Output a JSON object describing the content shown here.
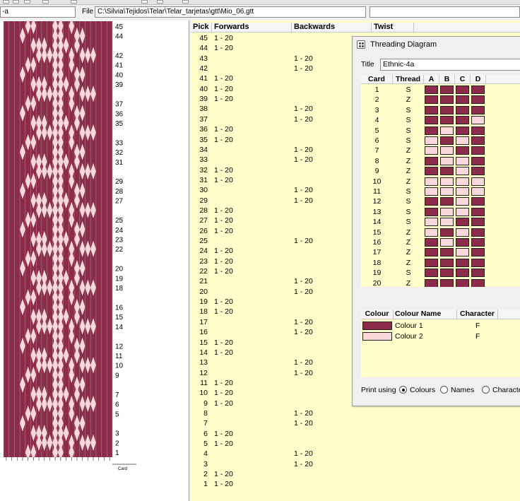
{
  "app": {
    "name_field_value": "-a",
    "file_label": "File",
    "file_path": "C:\\Silvia\\Tejidos\\Telar\\Telar_tarjetas\\gtt\\Mio_06.gtt"
  },
  "colors": {
    "colour1": "#8b2c4a",
    "colour2": "#f9d8dc",
    "pick_table_bg": "#ffffcc"
  },
  "draft": {
    "card_axis_label": "Card",
    "pick_axis_labels": [
      {
        "v": "45",
        "pick": 45
      },
      {
        "v": "44",
        "pick": 44
      },
      {
        "v": "42",
        "pick": 42
      },
      {
        "v": "41",
        "pick": 41
      },
      {
        "v": "40",
        "pick": 40
      },
      {
        "v": "39",
        "pick": 39
      },
      {
        "v": "37",
        "pick": 37
      },
      {
        "v": "36",
        "pick": 36
      },
      {
        "v": "35",
        "pick": 35
      },
      {
        "v": "33",
        "pick": 33
      },
      {
        "v": "32",
        "pick": 32
      },
      {
        "v": "31",
        "pick": 31
      },
      {
        "v": "29",
        "pick": 29
      },
      {
        "v": "28",
        "pick": 28
      },
      {
        "v": "27",
        "pick": 27
      },
      {
        "v": "25",
        "pick": 25
      },
      {
        "v": "24",
        "pick": 24
      },
      {
        "v": "23",
        "pick": 23
      },
      {
        "v": "22",
        "pick": 22
      },
      {
        "v": "20",
        "pick": 20
      },
      {
        "v": "19",
        "pick": 19
      },
      {
        "v": "18",
        "pick": 18
      },
      {
        "v": "16",
        "pick": 16
      },
      {
        "v": "15",
        "pick": 15
      },
      {
        "v": "14",
        "pick": 14
      },
      {
        "v": "12",
        "pick": 12
      },
      {
        "v": "11",
        "pick": 11
      },
      {
        "v": "10",
        "pick": 10
      },
      {
        "v": "9",
        "pick": 9
      },
      {
        "v": "7",
        "pick": 7
      },
      {
        "v": "6",
        "pick": 6
      },
      {
        "v": "5",
        "pick": 5
      },
      {
        "v": "3",
        "pick": 3
      },
      {
        "v": "2",
        "pick": 2
      },
      {
        "v": "1",
        "pick": 1
      }
    ]
  },
  "pick_table": {
    "headers": {
      "pick": "Pick",
      "forwards": "Forwards",
      "backwards": "Backwards",
      "twist": "Twist"
    },
    "rows": [
      {
        "pick": "45",
        "fwd": "1 - 20",
        "bwd": ""
      },
      {
        "pick": "44",
        "fwd": "1 - 20",
        "bwd": ""
      },
      {
        "pick": "43",
        "fwd": "",
        "bwd": "1 - 20"
      },
      {
        "pick": "42",
        "fwd": "",
        "bwd": "1 - 20"
      },
      {
        "pick": "41",
        "fwd": "1 - 20",
        "bwd": ""
      },
      {
        "pick": "40",
        "fwd": "1 - 20",
        "bwd": ""
      },
      {
        "pick": "39",
        "fwd": "1 - 20",
        "bwd": ""
      },
      {
        "pick": "38",
        "fwd": "",
        "bwd": "1 - 20"
      },
      {
        "pick": "37",
        "fwd": "",
        "bwd": "1 - 20"
      },
      {
        "pick": "36",
        "fwd": "1 - 20",
        "bwd": ""
      },
      {
        "pick": "35",
        "fwd": "1 - 20",
        "bwd": ""
      },
      {
        "pick": "34",
        "fwd": "",
        "bwd": "1 - 20"
      },
      {
        "pick": "33",
        "fwd": "",
        "bwd": "1 - 20"
      },
      {
        "pick": "32",
        "fwd": "1 - 20",
        "bwd": ""
      },
      {
        "pick": "31",
        "fwd": "1 - 20",
        "bwd": ""
      },
      {
        "pick": "30",
        "fwd": "",
        "bwd": "1 - 20"
      },
      {
        "pick": "29",
        "fwd": "",
        "bwd": "1 - 20"
      },
      {
        "pick": "28",
        "fwd": "1 - 20",
        "bwd": ""
      },
      {
        "pick": "27",
        "fwd": "1 - 20",
        "bwd": ""
      },
      {
        "pick": "26",
        "fwd": "1 - 20",
        "bwd": ""
      },
      {
        "pick": "25",
        "fwd": "",
        "bwd": "1 - 20"
      },
      {
        "pick": "24",
        "fwd": "1 - 20",
        "bwd": ""
      },
      {
        "pick": "23",
        "fwd": "1 - 20",
        "bwd": ""
      },
      {
        "pick": "22",
        "fwd": "1 - 20",
        "bwd": ""
      },
      {
        "pick": "21",
        "fwd": "",
        "bwd": "1 - 20"
      },
      {
        "pick": "20",
        "fwd": "",
        "bwd": "1 - 20"
      },
      {
        "pick": "19",
        "fwd": "1 - 20",
        "bwd": ""
      },
      {
        "pick": "18",
        "fwd": "1 - 20",
        "bwd": ""
      },
      {
        "pick": "17",
        "fwd": "",
        "bwd": "1 - 20"
      },
      {
        "pick": "16",
        "fwd": "",
        "bwd": "1 - 20"
      },
      {
        "pick": "15",
        "fwd": "1 - 20",
        "bwd": ""
      },
      {
        "pick": "14",
        "fwd": "1 - 20",
        "bwd": ""
      },
      {
        "pick": "13",
        "fwd": "",
        "bwd": "1 - 20"
      },
      {
        "pick": "12",
        "fwd": "",
        "bwd": "1 - 20"
      },
      {
        "pick": "11",
        "fwd": "1 - 20",
        "bwd": ""
      },
      {
        "pick": "10",
        "fwd": "1 - 20",
        "bwd": ""
      },
      {
        "pick": "9",
        "fwd": "1 - 20",
        "bwd": ""
      },
      {
        "pick": "8",
        "fwd": "",
        "bwd": "1 - 20"
      },
      {
        "pick": "7",
        "fwd": "",
        "bwd": "1 - 20"
      },
      {
        "pick": "6",
        "fwd": "1 - 20",
        "bwd": ""
      },
      {
        "pick": "5",
        "fwd": "1 - 20",
        "bwd": ""
      },
      {
        "pick": "4",
        "fwd": "",
        "bwd": "1 - 20"
      },
      {
        "pick": "3",
        "fwd": "",
        "bwd": "1 - 20"
      },
      {
        "pick": "2",
        "fwd": "1 - 20",
        "bwd": ""
      },
      {
        "pick": "1",
        "fwd": "1 - 20",
        "bwd": ""
      }
    ]
  },
  "threading_window": {
    "title": "Threading Diagram",
    "title_label": "Title",
    "title_value": "Ethnic-4a",
    "headers": {
      "card": "Card",
      "thread": "Thread",
      "a": "A",
      "b": "B",
      "c": "C",
      "d": "D"
    },
    "cards": [
      {
        "card": "1",
        "thread": "S",
        "holes": [
          1,
          1,
          1,
          1
        ]
      },
      {
        "card": "2",
        "thread": "Z",
        "holes": [
          1,
          1,
          1,
          1
        ]
      },
      {
        "card": "3",
        "thread": "S",
        "holes": [
          1,
          1,
          1,
          1
        ]
      },
      {
        "card": "4",
        "thread": "S",
        "holes": [
          1,
          1,
          1,
          2
        ]
      },
      {
        "card": "5",
        "thread": "S",
        "holes": [
          1,
          2,
          1,
          1
        ]
      },
      {
        "card": "6",
        "thread": "S",
        "holes": [
          2,
          1,
          2,
          1
        ]
      },
      {
        "card": "7",
        "thread": "Z",
        "holes": [
          2,
          2,
          1,
          1
        ]
      },
      {
        "card": "8",
        "thread": "Z",
        "holes": [
          1,
          2,
          2,
          1
        ]
      },
      {
        "card": "9",
        "thread": "Z",
        "holes": [
          1,
          1,
          2,
          1
        ]
      },
      {
        "card": "10",
        "thread": "Z",
        "holes": [
          2,
          2,
          2,
          2
        ]
      },
      {
        "card": "11",
        "thread": "S",
        "holes": [
          2,
          2,
          2,
          2
        ]
      },
      {
        "card": "12",
        "thread": "S",
        "holes": [
          1,
          1,
          2,
          1
        ]
      },
      {
        "card": "13",
        "thread": "S",
        "holes": [
          1,
          2,
          2,
          1
        ]
      },
      {
        "card": "14",
        "thread": "S",
        "holes": [
          2,
          2,
          1,
          1
        ]
      },
      {
        "card": "15",
        "thread": "Z",
        "holes": [
          2,
          1,
          2,
          1
        ]
      },
      {
        "card": "16",
        "thread": "Z",
        "holes": [
          1,
          2,
          1,
          1
        ]
      },
      {
        "card": "17",
        "thread": "Z",
        "holes": [
          1,
          1,
          2,
          1
        ]
      },
      {
        "card": "18",
        "thread": "Z",
        "holes": [
          1,
          1,
          1,
          1
        ]
      },
      {
        "card": "19",
        "thread": "S",
        "holes": [
          1,
          1,
          1,
          1
        ]
      },
      {
        "card": "20",
        "thread": "Z",
        "holes": [
          1,
          1,
          1,
          1
        ]
      }
    ],
    "colour_headers": {
      "colour": "Colour",
      "name": "Colour Name",
      "character": "Character"
    },
    "colours": [
      {
        "name": "Colour 1",
        "char": "F",
        "hex": "#8b2c4a"
      },
      {
        "name": "Colour 2",
        "char": "F",
        "hex": "#f9d8dc"
      }
    ],
    "print_using_label": "Print using",
    "print_options": [
      {
        "label": "Colours",
        "checked": true
      },
      {
        "label": "Names",
        "checked": false
      },
      {
        "label": "Characte",
        "checked": false
      }
    ]
  }
}
